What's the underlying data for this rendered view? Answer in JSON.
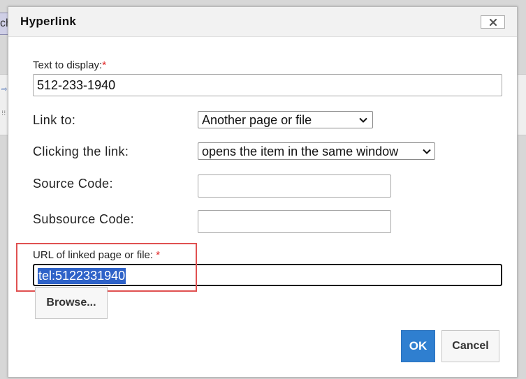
{
  "background": {
    "tab_fragment": "ch",
    "glyph_a": "⇨",
    "glyph_b": "⁝⁝"
  },
  "dialog": {
    "title": "Hyperlink",
    "close_icon": "close-x-icon",
    "fields": {
      "text_to_display": {
        "label": "Text to display:",
        "required_mark": "*",
        "value": "512-233-1940"
      },
      "link_to": {
        "label": "Link to:",
        "selected": "Another page or file"
      },
      "clicking_link": {
        "label": "Clicking the link:",
        "selected": "opens the item in the same window"
      },
      "source_code": {
        "label": "Source Code:",
        "value": ""
      },
      "subsource_code": {
        "label": "Subsource Code:",
        "value": ""
      },
      "url": {
        "label": "URL of linked page or file: ",
        "required_mark": "*",
        "value": "tel:5122331940"
      }
    },
    "buttons": {
      "browse": "Browse...",
      "ok": "OK",
      "cancel": "Cancel"
    }
  },
  "colors": {
    "required": "#e02020",
    "ok_button": "#2f7fd0",
    "selection": "#2e62c8",
    "highlight": "#e05151"
  }
}
